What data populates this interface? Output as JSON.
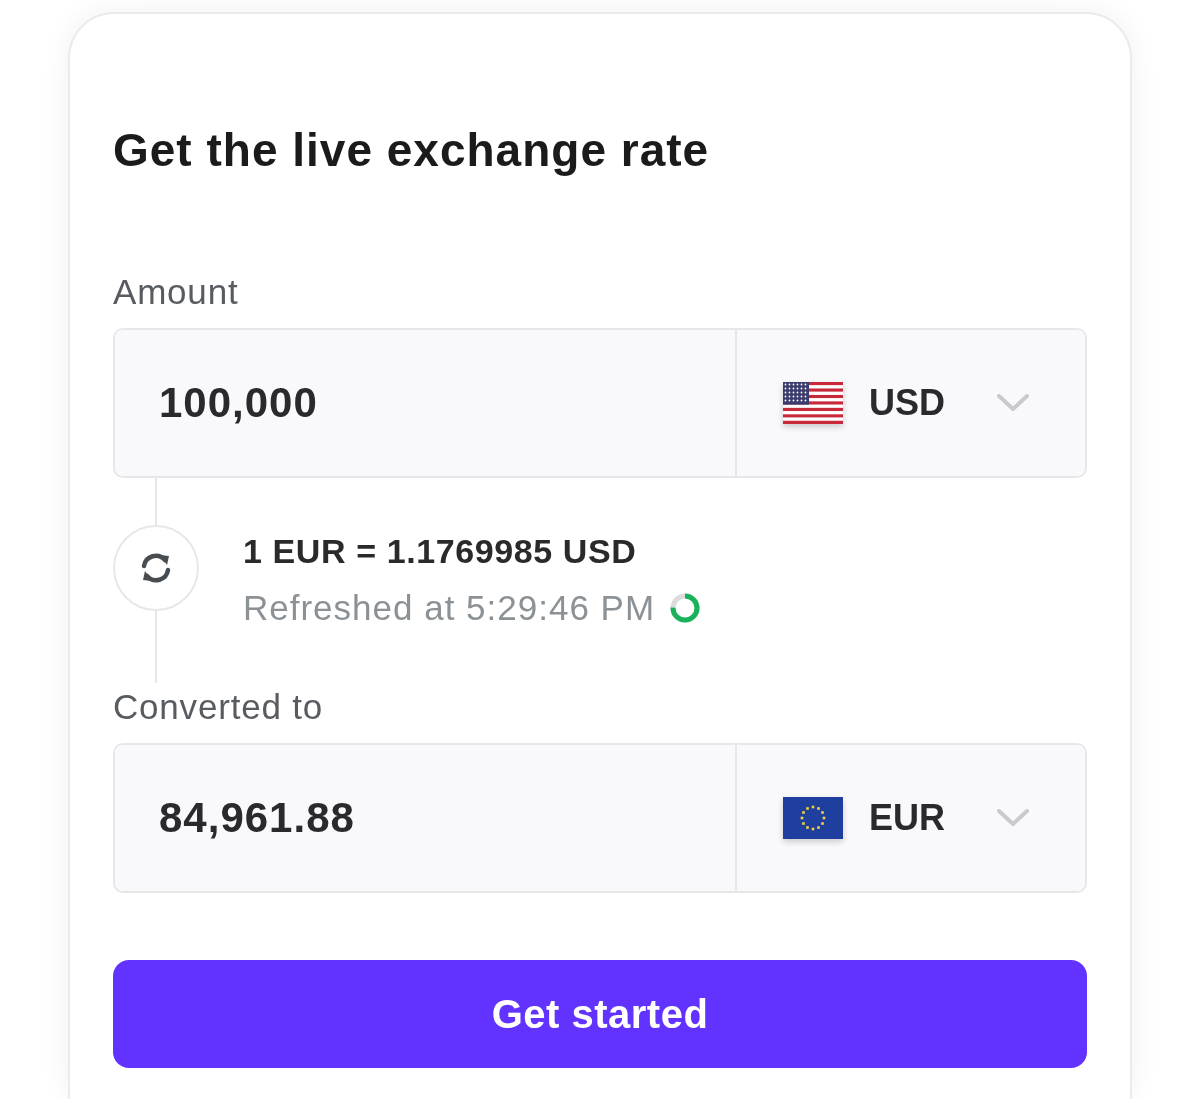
{
  "title": "Get the live exchange rate",
  "fields": [
    {
      "label": "Amount",
      "value": "100,000",
      "currency": "USD"
    },
    {
      "label": "Converted to",
      "value": "84,961.88",
      "currency": "EUR"
    }
  ],
  "rate": {
    "text": "1 EUR = 1.1769985 USD",
    "refreshed": "Refreshed at 5:29:46 PM",
    "level": 0.75
  },
  "button": {
    "label": "Get started"
  }
}
